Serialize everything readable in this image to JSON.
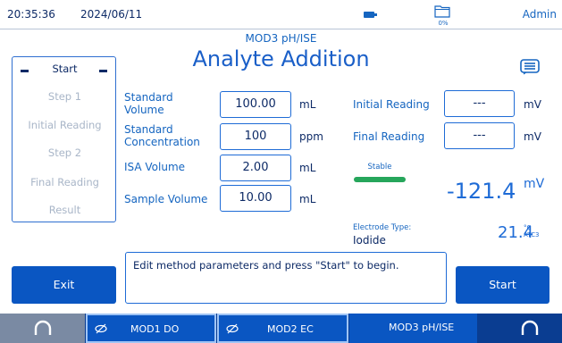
{
  "status": {
    "time": "20:35:36",
    "date": "2024/06/11",
    "storage": "0%",
    "user": "Admin"
  },
  "header": {
    "module": "MOD3 pH/ISE",
    "title": "Analyte Addition",
    "notes_icon": "notes-icon"
  },
  "steps": [
    "Start",
    "Step 1",
    "Initial Reading",
    "Step 2",
    "Final Reading",
    "Result"
  ],
  "active_step": "Start",
  "params": {
    "std_volume": {
      "label": "Standard\nVolume",
      "value": "100.00",
      "unit": "mL"
    },
    "std_conc": {
      "label": "Standard\nConcentration",
      "value": "100",
      "unit": "ppm"
    },
    "isa_volume": {
      "label": "ISA Volume",
      "value": "2.00",
      "unit": "mL"
    },
    "sample_volume": {
      "label": "Sample Volume",
      "value": "10.00",
      "unit": "mL"
    }
  },
  "readings": {
    "initial": {
      "label": "Initial Reading",
      "value": "---",
      "unit": "mV"
    },
    "final": {
      "label": "Final Reading",
      "value": "---",
      "unit": "mV"
    }
  },
  "stability": {
    "text": "Stable",
    "color": "#26a65b"
  },
  "live": {
    "value": "-121.4",
    "unit": "mV"
  },
  "electrode": {
    "label": "Electrode Type:",
    "value": "Iodide"
  },
  "temperature": {
    "value": "21.4",
    "unit": "°C",
    "mode": "ATC3"
  },
  "message": "Edit method parameters and press \"Start\" to begin.",
  "buttons": {
    "exit": "Exit",
    "start": "Start"
  },
  "tabs": {
    "mod1": "MOD1 DO",
    "mod2": "MOD2 EC",
    "mod3": "MOD3 pH/ISE",
    "left_icon": "headphones-icon",
    "right_icon": "headphones-icon"
  },
  "colors": {
    "accent": "#0a56c2",
    "nav_bar": "#0a3d91",
    "active_text": "#0d2a66"
  }
}
